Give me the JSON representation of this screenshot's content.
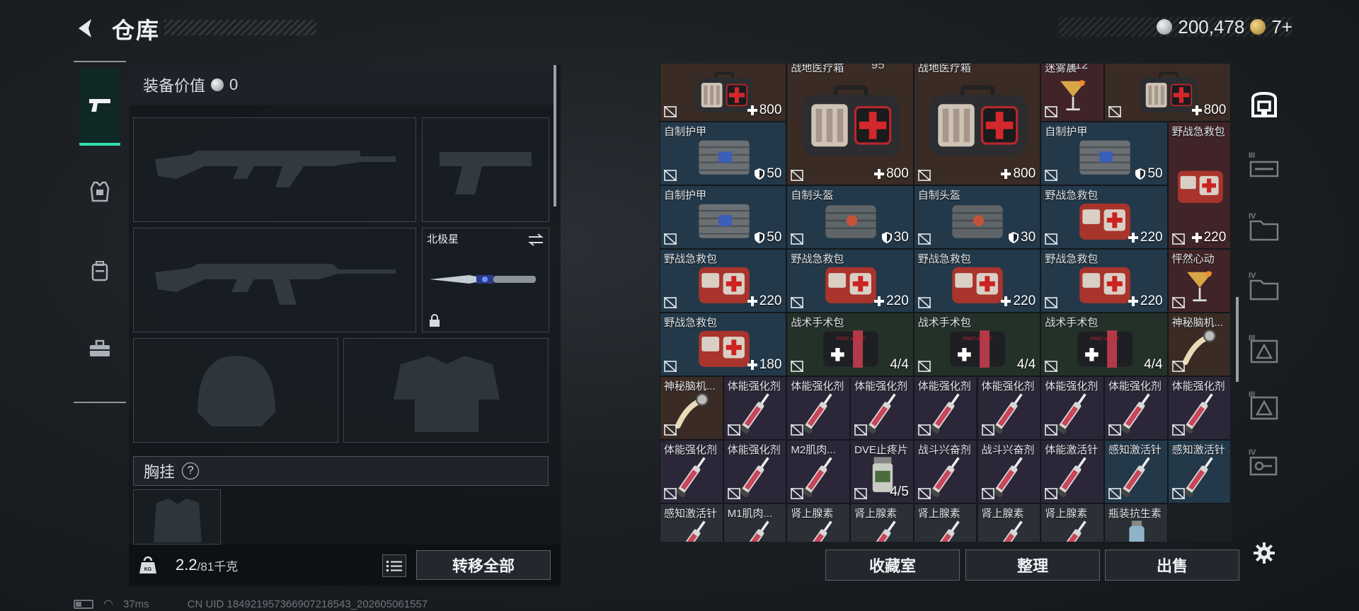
{
  "header": {
    "title": "仓库"
  },
  "currency": {
    "coins": "200,478",
    "tickets": "7+"
  },
  "loadout": {
    "equip_value_label": "装备价值",
    "equip_value": "0",
    "melee_name": "北极星",
    "chest_rig_label": "胸挂",
    "chest_rig_help": "?",
    "weight_current": "2.2",
    "weight_max": "/81千克",
    "transfer_all": "转移全部"
  },
  "inventory": {
    "cells": [
      {
        "name": "",
        "value": "800",
        "icon": "medkit-icon",
        "bg": "brown"
      },
      {
        "name": "战地医疗箱",
        "value": "800",
        "icon": "medkit-icon",
        "bg": "brown"
      },
      {
        "name": "战地医疗箱",
        "value": "800",
        "icon": "medkit-icon",
        "bg": "brown"
      },
      {
        "name": "迷雾晨",
        "value": "",
        "icon": "cocktail-icon",
        "bg": "red"
      },
      {
        "name": "",
        "value": "800",
        "icon": "medkit-icon",
        "bg": "brown"
      },
      {
        "name": "自制护甲",
        "value": "50",
        "icon": "armor-plate-icon",
        "bg": "blue"
      },
      {
        "name": "自制护甲",
        "value": "50",
        "icon": "armor-plate-icon",
        "bg": "blue"
      },
      {
        "name": "野战急救包",
        "value": "220",
        "icon": "first-aid-pouch-icon",
        "bg": "red"
      },
      {
        "name": "自制护甲",
        "value": "50",
        "icon": "armor-plate-icon",
        "bg": "blue"
      },
      {
        "name": "自制头盔",
        "value": "30",
        "icon": "helmet-icon",
        "bg": "blue"
      },
      {
        "name": "自制头盔",
        "value": "30",
        "icon": "helmet-icon",
        "bg": "blue"
      },
      {
        "name": "野战急救包",
        "value": "220",
        "icon": "first-aid-pouch-icon",
        "bg": "blue"
      },
      {
        "name": "野战急救包",
        "value": "220",
        "icon": "first-aid-pouch-icon",
        "bg": "blue"
      },
      {
        "name": "野战急救包",
        "value": "220",
        "icon": "first-aid-pouch-icon",
        "bg": "blue"
      },
      {
        "name": "野战急救包",
        "value": "220",
        "icon": "first-aid-pouch-icon",
        "bg": "blue"
      },
      {
        "name": "野战急救包",
        "value": "220",
        "icon": "first-aid-pouch-icon",
        "bg": "blue"
      },
      {
        "name": "怦然心动",
        "value": "",
        "icon": "cocktail-icon",
        "bg": "red"
      },
      {
        "name": "野战急救包",
        "value": "180",
        "icon": "first-aid-pouch-icon",
        "bg": "blue"
      },
      {
        "name": "战术手术包",
        "value": "4/4",
        "icon": "surgery-kit-icon",
        "bg": "green"
      },
      {
        "name": "战术手术包",
        "value": "4/4",
        "icon": "surgery-kit-icon",
        "bg": "green"
      },
      {
        "name": "战术手术包",
        "value": "4/4",
        "icon": "surgery-kit-icon",
        "bg": "green"
      },
      {
        "name": "神秘脑机...",
        "value": "",
        "icon": "brain-chip-icon",
        "bg": "brown"
      },
      {
        "name": "神秘脑机...",
        "value": "",
        "icon": "brain-chip-icon",
        "bg": "brown"
      },
      {
        "name": "体能强化剂",
        "value": "",
        "icon": "syringe-icon",
        "bg": "purple"
      },
      {
        "name": "体能强化剂",
        "value": "",
        "icon": "syringe-icon",
        "bg": "purple"
      },
      {
        "name": "体能强化剂",
        "value": "",
        "icon": "syringe-icon",
        "bg": "purple"
      },
      {
        "name": "体能强化剂",
        "value": "",
        "icon": "syringe-icon",
        "bg": "purple"
      },
      {
        "name": "体能强化剂",
        "value": "",
        "icon": "syringe-icon",
        "bg": "purple"
      },
      {
        "name": "体能强化剂",
        "value": "",
        "icon": "syringe-icon",
        "bg": "purple"
      },
      {
        "name": "体能强化剂",
        "value": "",
        "icon": "syringe-icon",
        "bg": "purple"
      },
      {
        "name": "体能强化剂",
        "value": "",
        "icon": "syringe-icon",
        "bg": "purple"
      },
      {
        "name": "体能强化剂",
        "value": "",
        "icon": "syringe-icon",
        "bg": "purple"
      },
      {
        "name": "体能强化剂",
        "value": "",
        "icon": "syringe-icon",
        "bg": "purple"
      },
      {
        "name": "M2肌肉...",
        "value": "",
        "icon": "syringe-icon",
        "bg": "purple"
      },
      {
        "name": "DVE止疼片",
        "value": "4/5",
        "icon": "pill-bottle-icon",
        "bg": "purple"
      },
      {
        "name": "战斗兴奋剂",
        "value": "",
        "icon": "syringe-icon",
        "bg": "purple"
      },
      {
        "name": "战斗兴奋剂",
        "value": "",
        "icon": "syringe-icon",
        "bg": "purple"
      },
      {
        "name": "体能激活针",
        "value": "",
        "icon": "syringe-icon",
        "bg": "purple"
      },
      {
        "name": "感知激活针",
        "value": "",
        "icon": "syringe-icon",
        "bg": "blue"
      },
      {
        "name": "感知激活针",
        "value": "",
        "icon": "syringe-icon",
        "bg": "blue"
      },
      {
        "name": "感知激活针",
        "value": "",
        "icon": "syringe-icon",
        "bg": "gray"
      },
      {
        "name": "M1肌肉...",
        "value": "",
        "icon": "syringe-icon",
        "bg": "gray"
      },
      {
        "name": "肾上腺素",
        "value": "",
        "icon": "syringe-icon",
        "bg": "gray"
      },
      {
        "name": "肾上腺素",
        "value": "",
        "icon": "syringe-icon",
        "bg": "gray"
      },
      {
        "name": "肾上腺素",
        "value": "",
        "icon": "syringe-icon",
        "bg": "gray"
      },
      {
        "name": "肾上腺素",
        "value": "",
        "icon": "syringe-icon",
        "bg": "gray"
      },
      {
        "name": "肾上腺素",
        "value": "",
        "icon": "syringe-icon",
        "bg": "gray"
      },
      {
        "name": "瓶装抗生素",
        "value": "",
        "icon": "vial-icon",
        "bg": "gray"
      }
    ],
    "top_peek": [
      "95",
      "112"
    ]
  },
  "side_tabs": [
    {
      "level": "",
      "icon": "locker-icon",
      "active": true
    },
    {
      "level": "III",
      "icon": "rifle-case-icon",
      "active": false
    },
    {
      "level": "IV",
      "icon": "folder-case-icon",
      "active": false
    },
    {
      "level": "IV",
      "icon": "folder-case-icon",
      "active": false
    },
    {
      "level": "III",
      "icon": "pyramid-case-icon",
      "active": false
    },
    {
      "level": "III",
      "icon": "pyramid-case-icon",
      "active": false
    },
    {
      "level": "IV",
      "icon": "key-case-icon",
      "active": false
    }
  ],
  "bottom_buttons": {
    "collection": "收藏室",
    "organize": "整理",
    "sell": "出售"
  },
  "status": {
    "ping": "37ms",
    "uid": "CN UID 1849219573669072185​43_202605061557"
  }
}
